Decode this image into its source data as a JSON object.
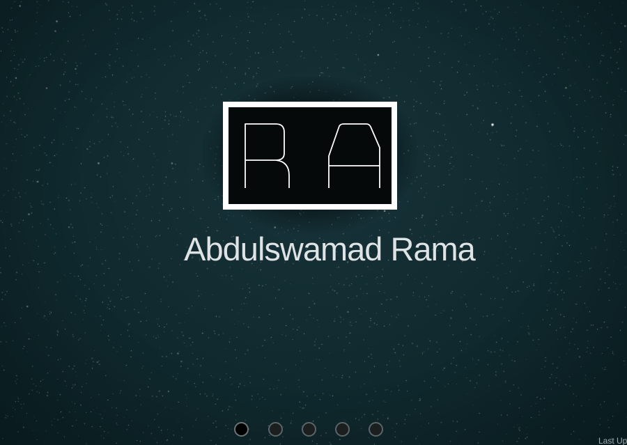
{
  "background": {
    "base_color": "#10292e",
    "star_color": "#ffffff"
  },
  "logo": {
    "text": "RA",
    "icon": "monogram-logo-icon",
    "border_color": "#ffffff",
    "fill_color": "#05090a"
  },
  "profile": {
    "name": "Abdulswamad Rama"
  },
  "pagination": {
    "total": 5,
    "active_index": 0
  },
  "footer": {
    "last_updated_label": "Last Up"
  }
}
